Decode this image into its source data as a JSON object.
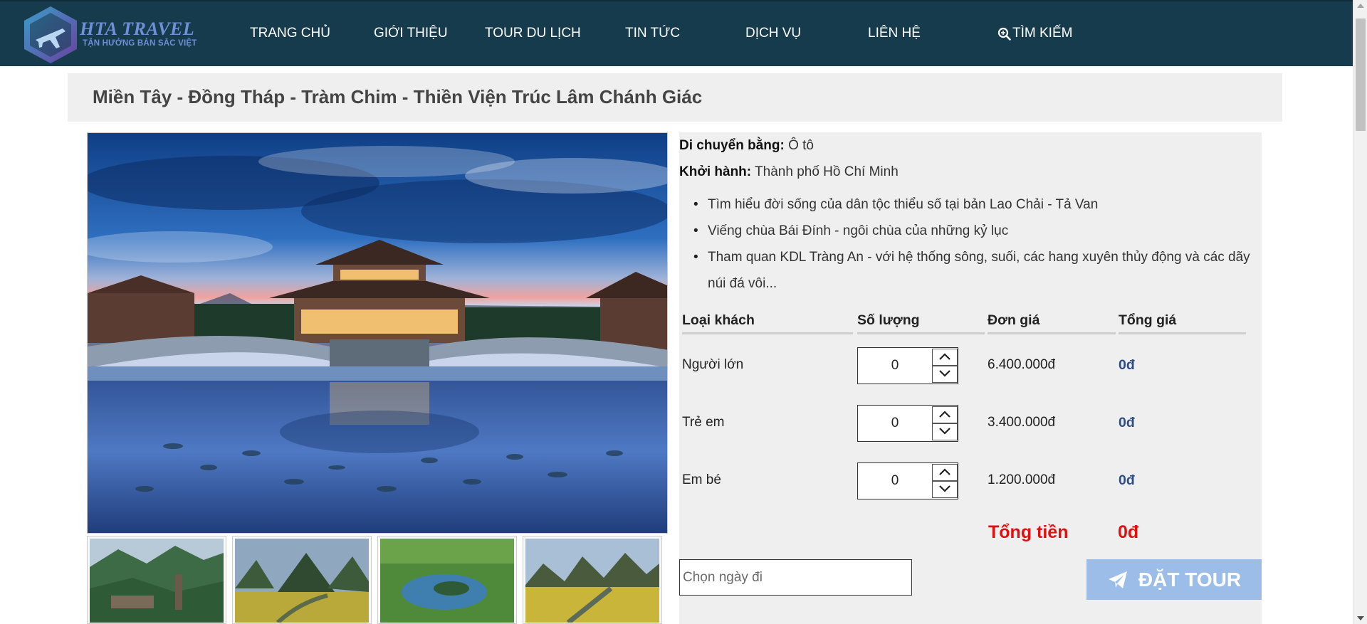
{
  "header": {
    "logo_title": "HTA TRAVEL",
    "logo_slogan": "TẬN HƯỞNG BẢN SẮC VIỆT",
    "nav": [
      {
        "label": "TRANG CHỦ"
      },
      {
        "label": "GIỚI THIỆU"
      },
      {
        "label": "TOUR DU LỊCH"
      },
      {
        "label": "TIN TỨC"
      },
      {
        "label": "DỊCH VỤ"
      },
      {
        "label": "LIÊN HỆ"
      },
      {
        "label": "TÌM KIẾM",
        "icon": "search-icon"
      }
    ]
  },
  "tour": {
    "title": "Miền Tây - Đồng Tháp - Tràm Chim - Thiền Viện Trúc Lâm Chánh Giác",
    "transport_label": "Di chuyển bằng:",
    "transport_value": "Ô tô",
    "departure_label": "Khởi hành:",
    "departure_value": "Thành phố Hồ Chí Minh",
    "highlights": [
      "Tìm hiểu đời sống của dân tộc thiểu số tại bản Lao Chải - Tả Van",
      "Viếng chùa Bái Đính - ngôi chùa của những kỷ lục",
      "Tham quan KDL Tràng An - với hệ thống sông, suối, các hang xuyên thủy động và các dãy núi đá vôi..."
    ]
  },
  "pricing": {
    "headers": [
      "Loại khách",
      "Số lượng",
      "Đơn giá",
      "Tổng giá"
    ],
    "rows": [
      {
        "type": "Người lớn",
        "qty": "0",
        "unit_price": "6.400.000đ",
        "total": "0đ"
      },
      {
        "type": "Trẻ em",
        "qty": "0",
        "unit_price": "3.400.000đ",
        "total": "0đ"
      },
      {
        "type": "Em bé",
        "qty": "0",
        "unit_price": "1.200.000đ",
        "total": "0đ"
      }
    ],
    "grand_total_label": "Tổng tiền",
    "grand_total_value": "0đ"
  },
  "booking": {
    "date_placeholder": "Chọn ngày đi",
    "book_label": "ĐẶT TOUR",
    "book_icon": "paper-plane-icon"
  },
  "colors": {
    "nav_bg": "#163b4d",
    "accent_red": "#e30f0f",
    "total_blue": "#2d4d86",
    "button_bg": "#9bbde8"
  }
}
